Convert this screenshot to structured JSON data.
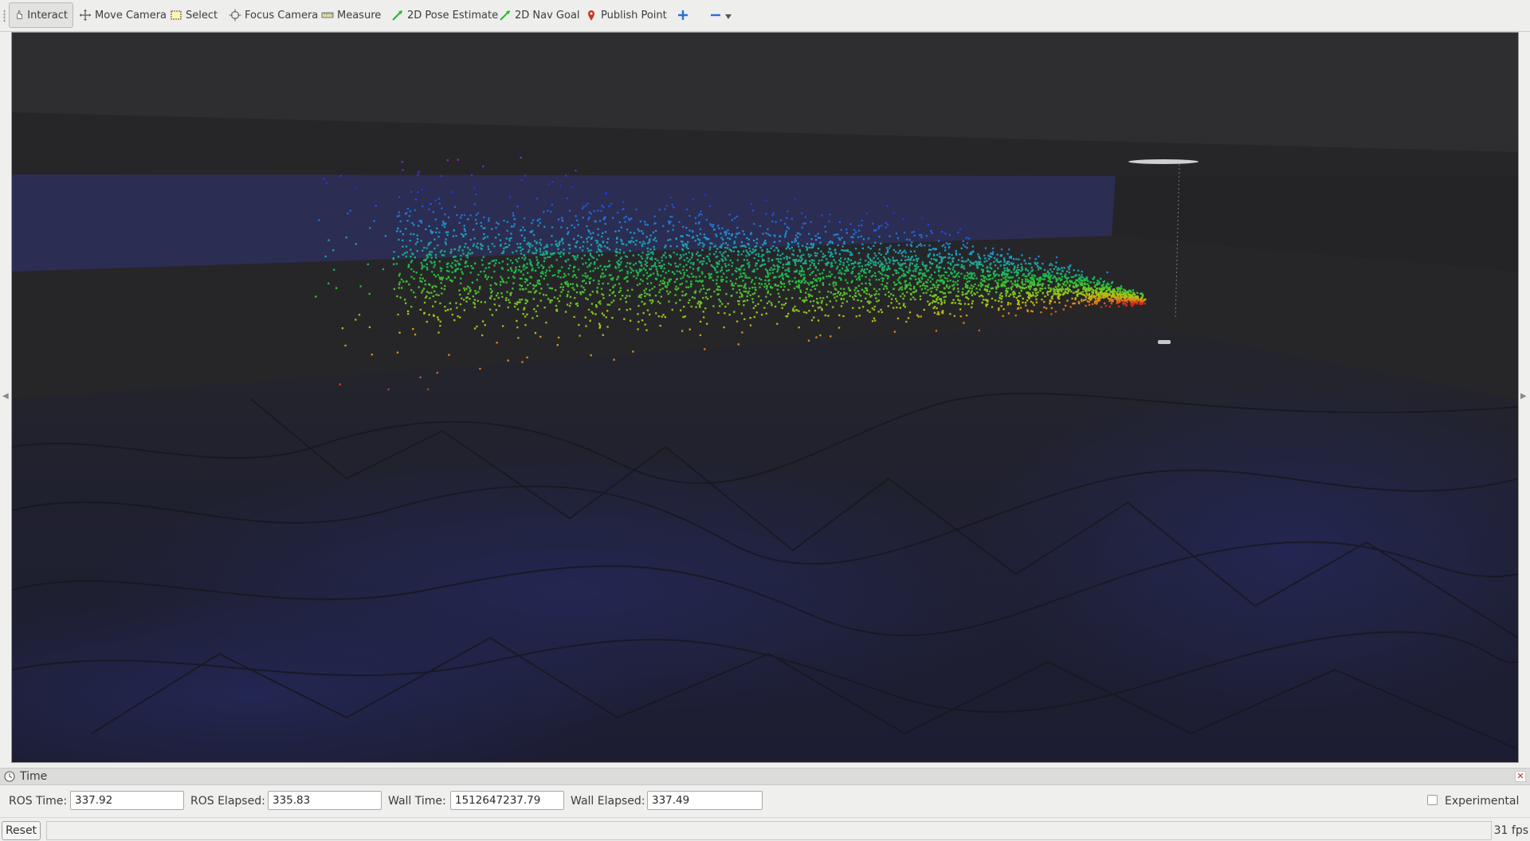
{
  "toolbar": {
    "tools": [
      {
        "label": "Interact",
        "icon": "hand-pointer-icon",
        "active": true
      },
      {
        "label": "Move Camera",
        "icon": "move-camera-icon",
        "active": false
      },
      {
        "label": "Select",
        "icon": "select-box-icon",
        "active": false
      },
      {
        "label": "Focus Camera",
        "icon": "focus-crosshair-icon",
        "active": false
      },
      {
        "label": "Measure",
        "icon": "ruler-icon",
        "active": false
      },
      {
        "label": "2D Pose Estimate",
        "icon": "green-arrow-icon",
        "active": false
      },
      {
        "label": "2D Nav Goal",
        "icon": "green-arrow-icon",
        "active": false
      },
      {
        "label": "Publish Point",
        "icon": "map-pin-icon",
        "active": false
      }
    ],
    "add_tool_icon": "plus-icon",
    "remove_tool_icon": "minus-dropdown-icon"
  },
  "time_panel": {
    "title": "Time",
    "ros_time_label": "ROS Time:",
    "ros_time": "337.92",
    "ros_elapsed_label": "ROS Elapsed:",
    "ros_elapsed": "335.83",
    "wall_time_label": "Wall Time:",
    "wall_time": "1512647237.79",
    "wall_elapsed_label": "Wall Elapsed:",
    "wall_elapsed": "337.49",
    "experimental_label": "Experimental",
    "experimental_checked": false
  },
  "status": {
    "reset_label": "Reset",
    "fps": "31 fps"
  },
  "colors": {
    "accent_active_tool": "#e2e2e1",
    "close_red": "#dd2222",
    "viewport_bg": "#232326"
  }
}
